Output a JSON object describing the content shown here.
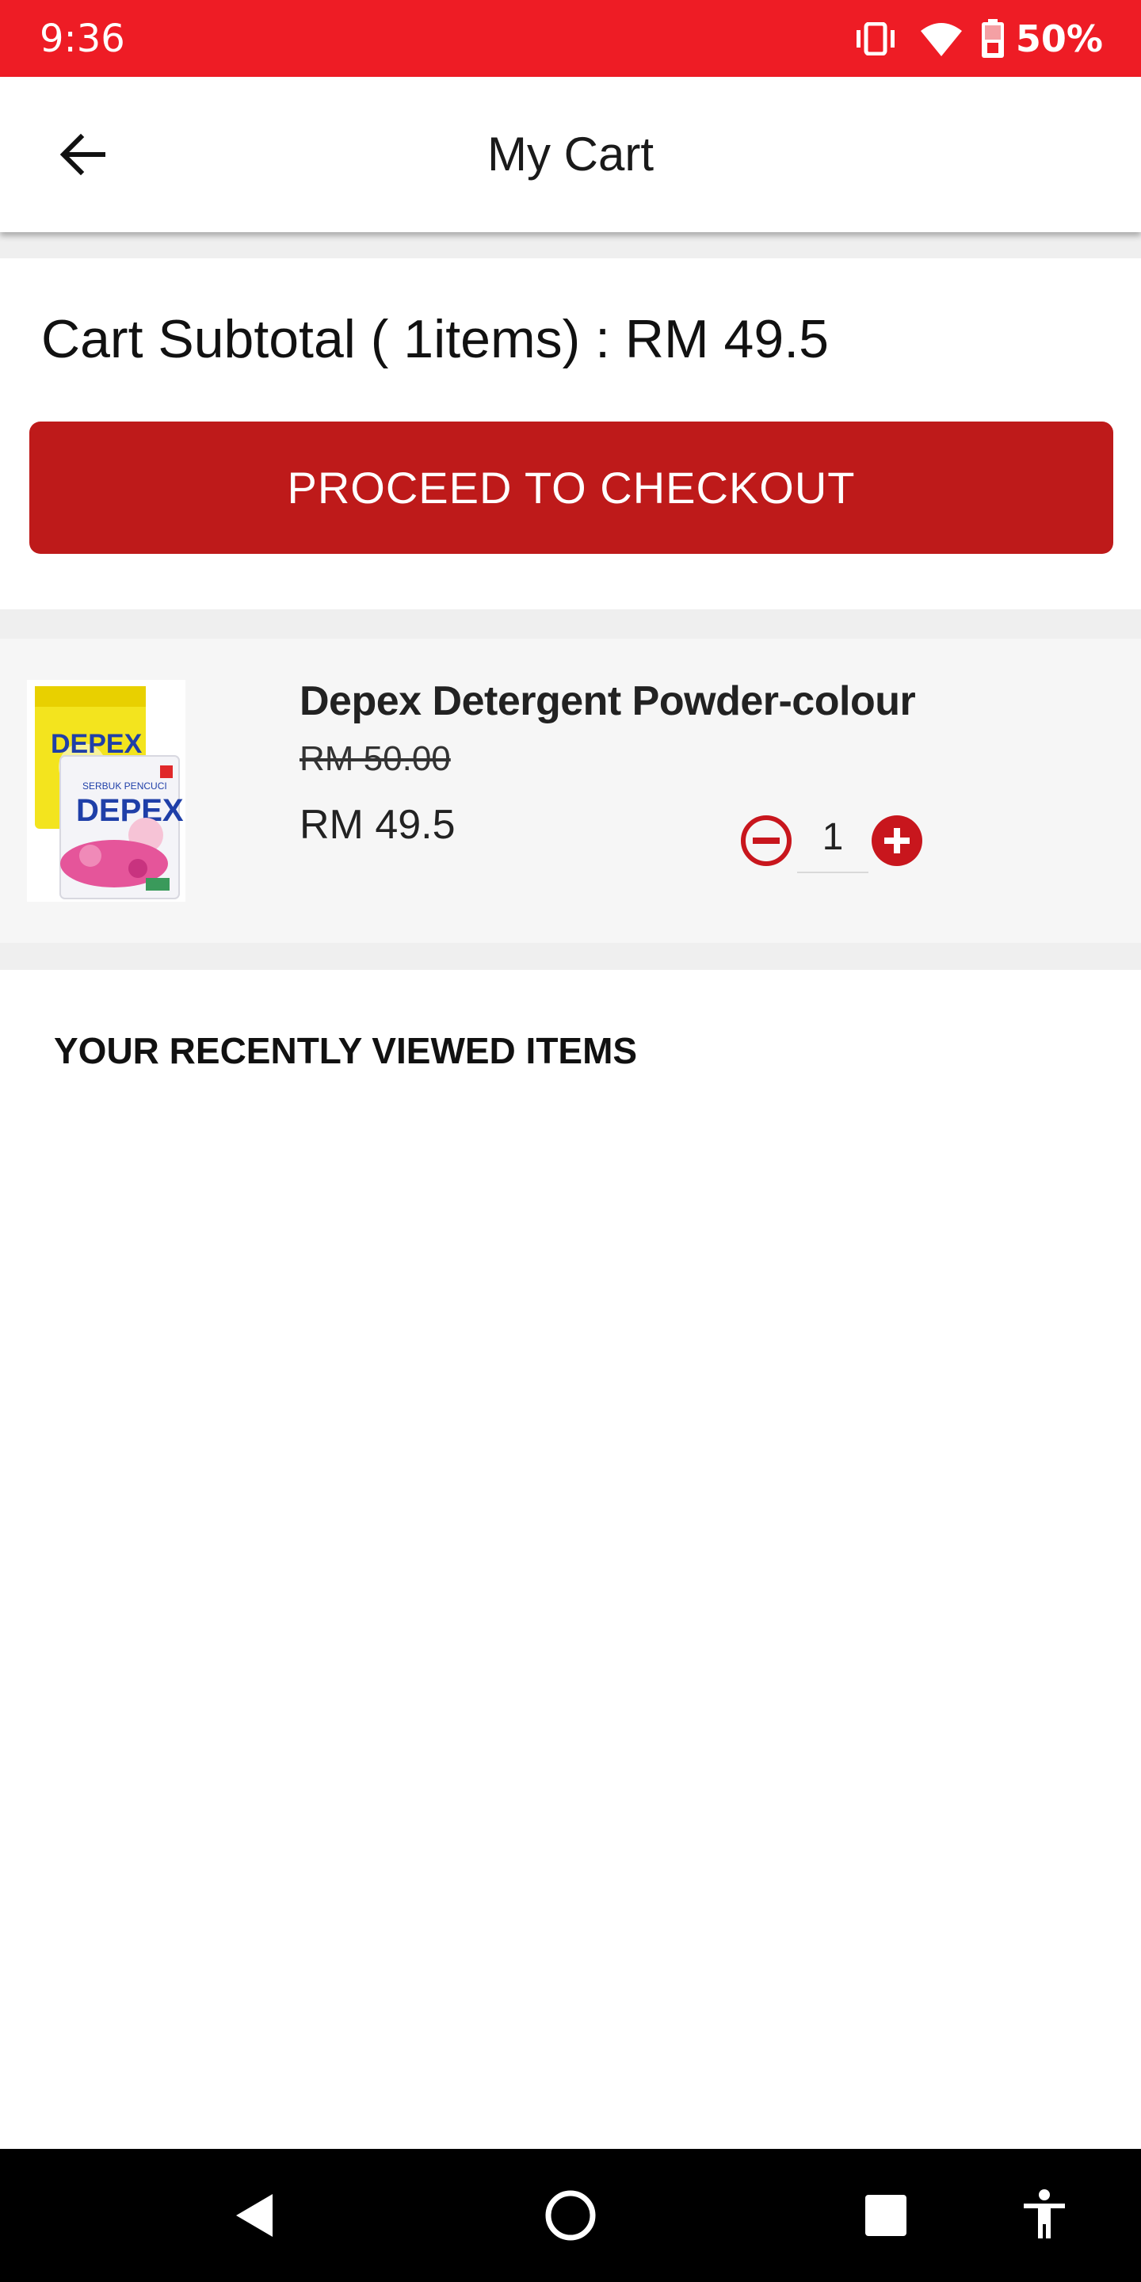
{
  "status_bar": {
    "time": "9:36",
    "battery_percent": "50%",
    "icons": [
      "vibrate-icon",
      "wifi-icon",
      "battery-icon"
    ],
    "background_color": "#ee1c25"
  },
  "app_bar": {
    "title": "My Cart",
    "back_icon": "arrow-left-icon"
  },
  "subtotal": {
    "label": "Cart Subtotal ( 1items) : RM 49.5"
  },
  "checkout": {
    "label": "PROCEED TO CHECKOUT",
    "color": "#be1a1a"
  },
  "cart_items": [
    {
      "name": "Depex Detergent Powder-colour",
      "old_price": "RM 50.00",
      "price": "RM 49.5",
      "quantity": "1",
      "image": "depex-detergent-packs",
      "image_text": "DEPEX"
    }
  ],
  "recently_viewed": {
    "heading": "YOUR RECENTLY VIEWED ITEMS",
    "items": []
  },
  "nav_bar": {
    "buttons": [
      "back-triangle-icon",
      "home-circle-icon",
      "recents-square-icon",
      "accessibility-icon"
    ]
  }
}
